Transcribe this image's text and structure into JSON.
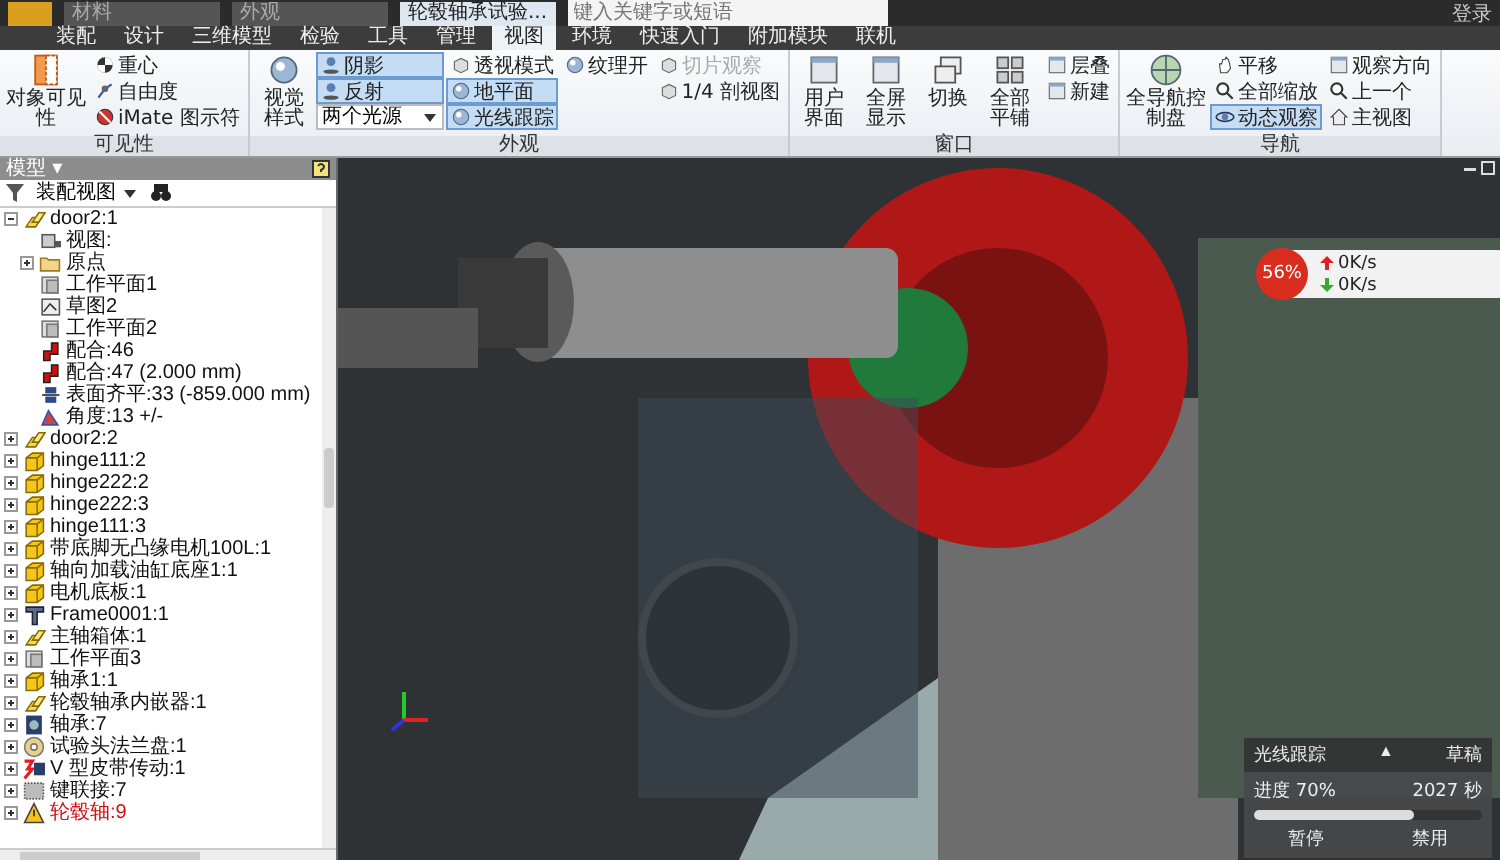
{
  "title_bar": {
    "material_box": "材料",
    "appearance_box": "外观",
    "title": "轮毂轴承试验...",
    "search": {
      "placeholder": "键入关键字或短语"
    },
    "login": "登录"
  },
  "tabs": [
    {
      "label": "装配",
      "selected": false
    },
    {
      "label": "设计",
      "selected": false
    },
    {
      "label": "三维模型",
      "selected": false
    },
    {
      "label": "检验",
      "selected": false
    },
    {
      "label": "工具",
      "selected": false
    },
    {
      "label": "管理",
      "selected": false
    },
    {
      "label": "视图",
      "selected": true
    },
    {
      "label": "环境",
      "selected": false
    },
    {
      "label": "快速入门",
      "selected": false
    },
    {
      "label": "附加模块",
      "selected": false
    },
    {
      "label": "联机",
      "selected": false
    }
  ],
  "ribbon": [
    {
      "title": "可见性",
      "groups": [
        [
          {
            "kind": "large",
            "label": "对象可见性"
          }
        ],
        [
          {
            "kind": "small",
            "label": "重心"
          },
          {
            "kind": "small",
            "label": "自由度"
          },
          {
            "kind": "small",
            "label": "iMate 图示符"
          }
        ]
      ]
    },
    {
      "title": "外观",
      "groups": [
        [
          {
            "kind": "large",
            "label": "视觉样式"
          }
        ],
        [
          {
            "kind": "toggle",
            "label": "阴影",
            "on": true
          },
          {
            "kind": "toggle",
            "label": "反射",
            "on": true
          },
          {
            "kind": "dropdown",
            "label": "两个光源"
          }
        ],
        [
          {
            "kind": "small",
            "label": "透视模式"
          },
          {
            "kind": "toggle",
            "label": "地平面",
            "on": true
          },
          {
            "kind": "toggle",
            "label": "光线跟踪",
            "on": true
          }
        ],
        [
          {
            "kind": "small",
            "label": "纹理开"
          }
        ],
        [
          {
            "kind": "small",
            "label": "切片观察",
            "disabled": true
          },
          {
            "kind": "small",
            "label": "1/4 剖视图",
            "disabled": false
          }
        ]
      ]
    },
    {
      "title": "窗口",
      "groups": [
        [
          {
            "kind": "large",
            "label": "用户界面"
          }
        ],
        [
          {
            "kind": "large",
            "label": "全屏显示"
          }
        ],
        [
          {
            "kind": "large",
            "label": "切换"
          }
        ],
        [
          {
            "kind": "large",
            "label": "全部平铺"
          }
        ],
        [
          {
            "kind": "small",
            "label": "层叠"
          },
          {
            "kind": "small",
            "label": "新建"
          }
        ]
      ]
    },
    {
      "title": "导航",
      "groups": [
        [
          {
            "kind": "large",
            "label": "全导航控制盘"
          }
        ],
        [
          {
            "kind": "small",
            "label": "平移"
          },
          {
            "kind": "small",
            "label": "全部缩放"
          },
          {
            "kind": "toggle",
            "label": "动态观察",
            "on": true
          }
        ],
        [
          {
            "kind": "small",
            "label": "观察方向"
          },
          {
            "kind": "small",
            "label": "上一个"
          },
          {
            "kind": "small",
            "label": "主视图"
          }
        ]
      ]
    }
  ],
  "browser": {
    "title": "模型 ▾",
    "view_selector": "装配视图",
    "tree": [
      {
        "label": "door2:1",
        "kind": "assembly",
        "expanded": true,
        "children": [
          {
            "label": "视图:",
            "kind": "view"
          },
          {
            "label": "原点",
            "kind": "folder",
            "expanded": false
          },
          {
            "label": "工作平面1",
            "kind": "plane"
          },
          {
            "label": "草图2",
            "kind": "sketch"
          },
          {
            "label": "工作平面2",
            "kind": "plane"
          },
          {
            "label": "配合:46",
            "kind": "mate"
          },
          {
            "label": "配合:47 (2.000 mm)",
            "kind": "mate"
          },
          {
            "label": "表面齐平:33 (-859.000 mm)",
            "kind": "flush"
          },
          {
            "label": "角度:13 +/-",
            "kind": "angle"
          }
        ]
      },
      {
        "label": "door2:2",
        "kind": "assembly",
        "expanded": false
      },
      {
        "label": "hinge111:2",
        "kind": "part",
        "expanded": false
      },
      {
        "label": "hinge222:2",
        "kind": "part",
        "expanded": false
      },
      {
        "label": "hinge222:3",
        "kind": "part",
        "expanded": false
      },
      {
        "label": "hinge111:3",
        "kind": "part",
        "expanded": false
      },
      {
        "label": "带底脚无凸缘电机100L:1",
        "kind": "part",
        "expanded": false
      },
      {
        "label": "轴向加载油缸底座1:1",
        "kind": "part",
        "expanded": false
      },
      {
        "label": "电机底板:1",
        "kind": "part",
        "expanded": false
      },
      {
        "label": "Frame0001:1",
        "kind": "frame",
        "expanded": false
      },
      {
        "label": "主轴箱体:1",
        "kind": "assembly",
        "expanded": false
      },
      {
        "label": "工作平面3",
        "kind": "plane",
        "expanded": false
      },
      {
        "label": "轴承1:1",
        "kind": "part",
        "expanded": false
      },
      {
        "label": "轮毂轴承内嵌器:1",
        "kind": "assembly",
        "expanded": false
      },
      {
        "label": "轴承:7",
        "kind": "bearing",
        "expanded": false
      },
      {
        "label": "试验头法兰盘:1",
        "kind": "flange",
        "expanded": false
      },
      {
        "label": "V 型皮带传动:1",
        "kind": "belt",
        "expanded": false
      },
      {
        "label": "键联接:7",
        "kind": "key",
        "expanded": false
      },
      {
        "label": "轮毂轴:9",
        "kind": "warning",
        "expanded": false
      }
    ]
  },
  "speed_widget": {
    "percent": "56%",
    "up": "0K/s",
    "down": "0K/s"
  },
  "ray_tracing": {
    "title": "光线跟踪",
    "collapse": "▲",
    "quality": "草稿",
    "progress_label": "进度 70%",
    "time": "2027 秒",
    "level": 0.7,
    "buttons": [
      "暂停",
      "禁用"
    ]
  }
}
